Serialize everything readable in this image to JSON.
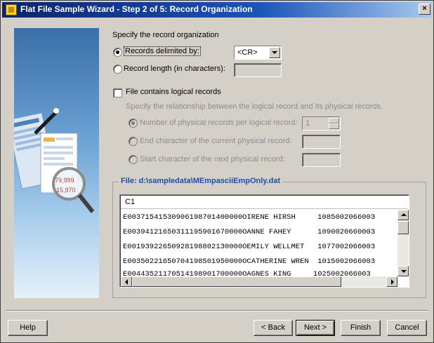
{
  "window": {
    "title": "Flat File Sample Wizard - Step 2 of 5: Record Organization",
    "close_glyph": "×"
  },
  "art": {
    "numbers": [
      "79,999",
      "15,970"
    ]
  },
  "organization": {
    "heading": "Specify the record organization",
    "delimited_label": "Records delimited by:",
    "delimited_selected": true,
    "delimiter_value": "<CR>",
    "length_label": "Record length (in characters):"
  },
  "logical": {
    "checkbox_label": "File contains logical records",
    "checked": false,
    "description": "Specify the relationship between the logical record and its physical records.",
    "num_physical_label": "Number of physical records per logical record:",
    "num_physical_value": "1",
    "end_char_label": "End character of the current physical record:",
    "start_char_label": "Start character of the next physical record:"
  },
  "file": {
    "title": "File: d:\\sampledata\\MEmpasciiEmpOnly.dat",
    "column_header": "C1",
    "rows": [
      "E00371541530906198701400000OIRENE HIRSH     1085002066003",
      "E00394121650311195901670000OANNE FAHEY      1090020660003",
      "E00193922650928198802130000OEMILY WELLMET   1077002066003",
      "E00350221650704198501950000OCATHERINE WREN  1015002066003",
      "E00443521170514198901700000OAGNES KING     1025002066003"
    ]
  },
  "buttons": {
    "help": "Help",
    "back": "< Back",
    "next": "Next >",
    "finish": "Finish",
    "cancel": "Cancel"
  }
}
